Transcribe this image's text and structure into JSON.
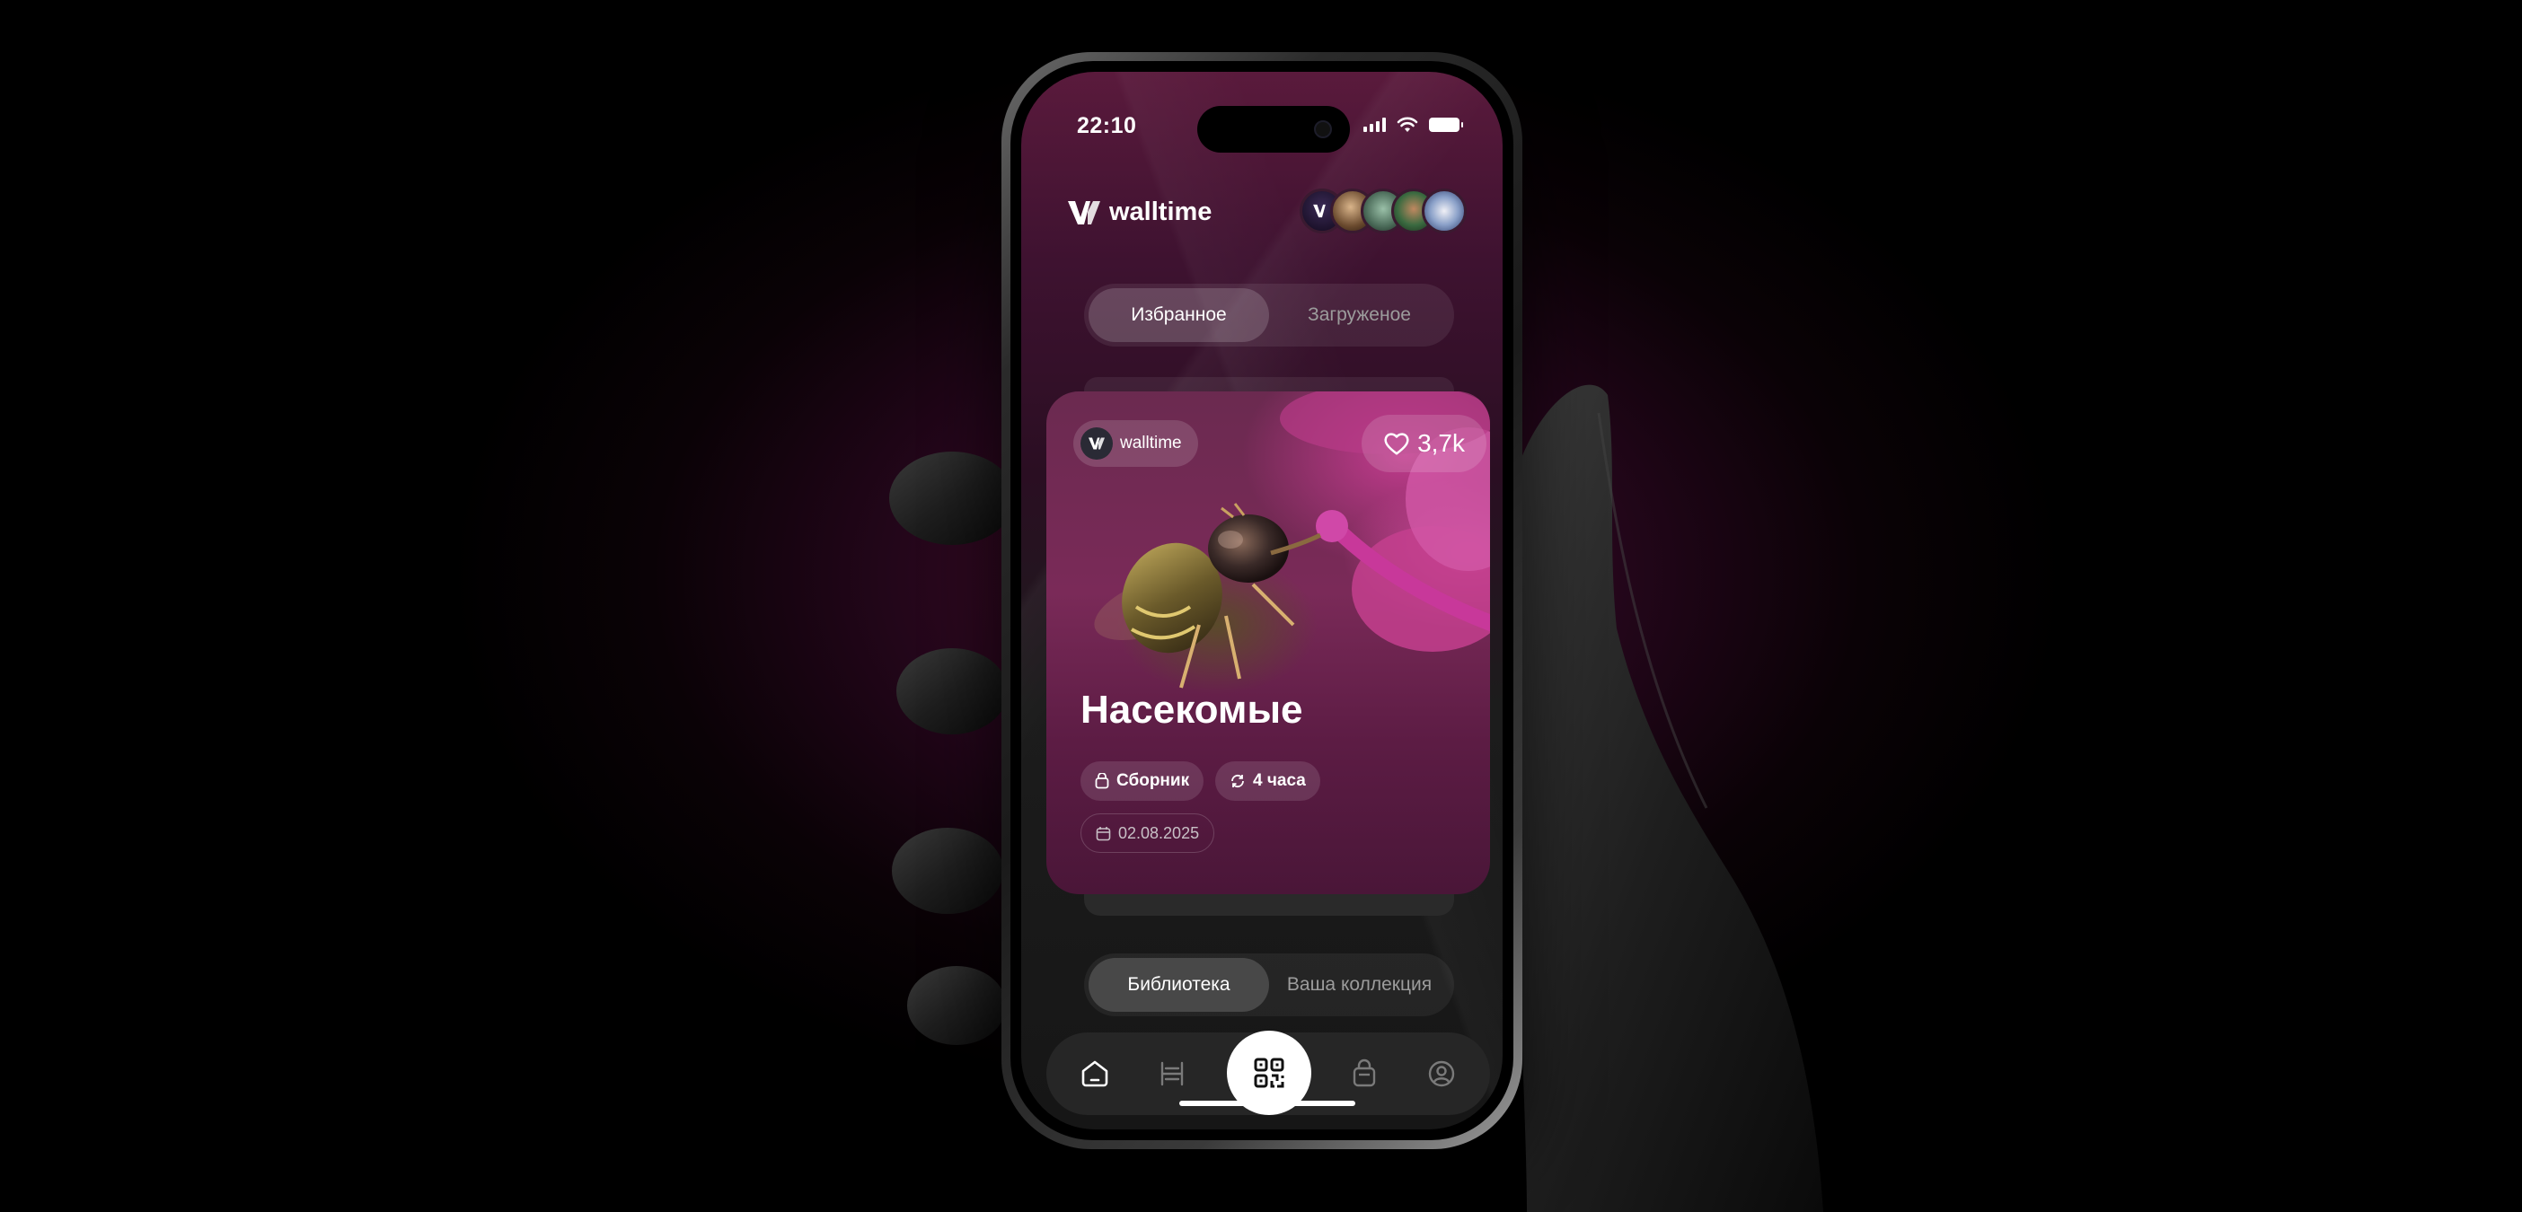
{
  "status_bar": {
    "time": "22:10"
  },
  "brand": {
    "name": "walltime"
  },
  "top_tabs": {
    "items": [
      "Избранное",
      "Загруженое"
    ],
    "active_index": 0
  },
  "card": {
    "author": "walltime",
    "likes": "3,7k",
    "title": "Насекомые",
    "tags": {
      "type": "Сборник",
      "update": "4 часа",
      "date": "02.08.2025"
    }
  },
  "bottom_tabs": {
    "items": [
      "Библиотека",
      "Ваша коллекция"
    ],
    "active_index": 0
  },
  "tabbar": {
    "items": [
      {
        "icon": "home-icon",
        "active": true
      },
      {
        "icon": "gallery-icon",
        "active": false
      },
      {
        "icon": "qr-code-icon",
        "active": false
      },
      {
        "icon": "bag-icon",
        "active": false
      },
      {
        "icon": "profile-icon",
        "active": false
      }
    ]
  },
  "colors": {
    "accent": "#c23c8e",
    "background": "#000000",
    "surface": "#262626"
  }
}
